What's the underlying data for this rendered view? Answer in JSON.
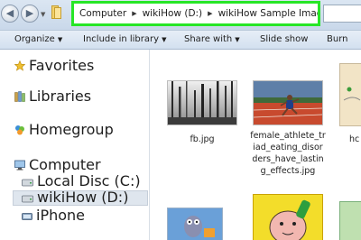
{
  "address_bar": {
    "nav_back_icon": "back-arrow-icon",
    "nav_forward_icon": "forward-arrow-icon",
    "recent_dropdown_icon": "chevron-down-icon",
    "breadcrumb": [
      "Computer",
      "wikiHow (D:)",
      "wikiHow Sample Images"
    ],
    "highlight_color": "#27e627"
  },
  "toolbar": {
    "organize": "Organize",
    "include_in_library": "Include in library",
    "share_with": "Share with",
    "slide_show": "Slide show",
    "burn": "Burn"
  },
  "nav_pane": {
    "favorites": "Favorites",
    "libraries": "Libraries",
    "homegroup": "Homegroup",
    "computer": "Computer",
    "local_disc": "Local Disc (C:)",
    "wikihow_drive": "wikiHow (D:)",
    "iphone": "iPhone",
    "selected_item": "wikiHow (D:)"
  },
  "files": [
    {
      "caption": "fb.jpg"
    },
    {
      "caption_lines": [
        "female_athlete_tr",
        "iad_eating_disor",
        "ders_have_lastin",
        "g_effects.jpg"
      ]
    },
    {
      "caption": "hc"
    }
  ]
}
